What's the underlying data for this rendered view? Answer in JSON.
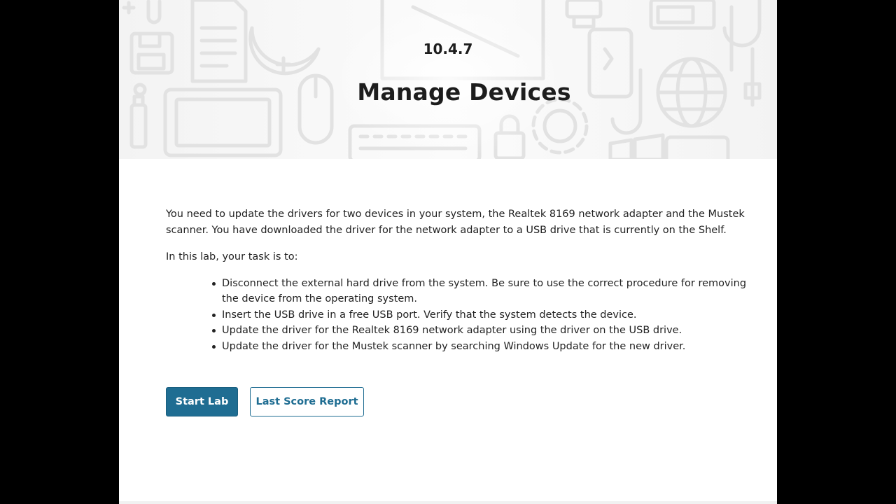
{
  "header": {
    "lab_number": "10.4.7",
    "title": "Manage Devices"
  },
  "content": {
    "intro": "You need to update the drivers for two devices in your system, the Realtek 8169 network adapter and the Mustek scanner. You have downloaded the driver for the network adapter to a USB drive that is currently on the Shelf.",
    "task_lead": "In this lab, your task is to:",
    "tasks": [
      "Disconnect the external hard drive from the system. Be sure to use the correct procedure for removing the device from the operating system.",
      "Insert the USB drive in a free USB port. Verify that the system detects the device.",
      "Update the driver for the Realtek 8169 network adapter using the driver on the USB drive.",
      "Update the driver for the Mustek scanner by searching Windows Update for the new driver."
    ]
  },
  "actions": {
    "start_label": "Start Lab",
    "report_label": "Last Score Report"
  },
  "colors": {
    "accent": "#1f6d92",
    "outside_background": "#000000",
    "page_background": "#ffffff"
  },
  "hero_icons": [
    "floppy-disk-icon",
    "document-icon",
    "usb-drive-icon",
    "mouse-icon",
    "keyboard-icon",
    "gear-icon",
    "lock-icon",
    "smartphone-icon",
    "globe-icon",
    "windows-logo-icon",
    "monitor-icon",
    "plug-icon"
  ]
}
